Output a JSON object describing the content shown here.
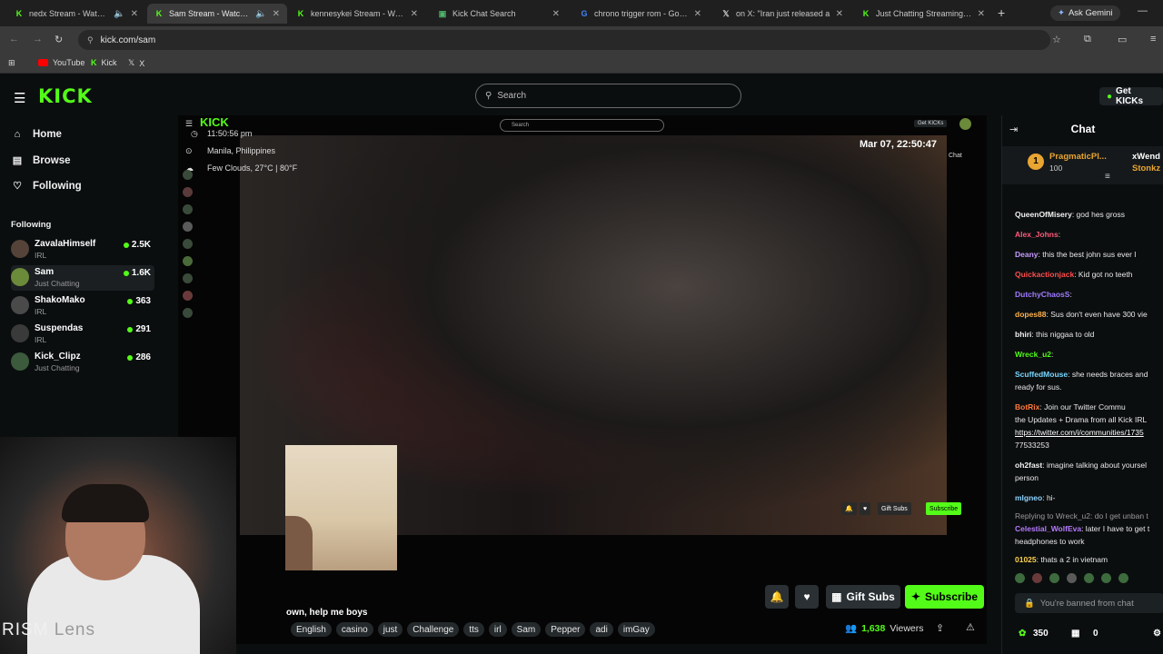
{
  "browser": {
    "tabs": [
      {
        "title": "nedx Stream - Watch Live",
        "active": false
      },
      {
        "title": "Sam Stream - Watch Live",
        "active": true
      },
      {
        "title": "kennesykei Stream - Watch",
        "active": false
      },
      {
        "title": "Kick Chat Search",
        "active": false
      },
      {
        "title": "chrono trigger rom - Google",
        "active": false
      },
      {
        "title": "on X: \"Iran just released a",
        "active": false
      },
      {
        "title": "Just Chatting Streaming - Li",
        "active": false
      }
    ],
    "new_tab": "+",
    "gemini_label": "Ask Gemini",
    "url": "kick.com/sam",
    "bookmarks": [
      "YouTube",
      "Kick",
      "X"
    ]
  },
  "header": {
    "logo": "KICK",
    "search_placeholder": "Search",
    "get_kicks": "Get KICKs"
  },
  "sidebar": {
    "nav": [
      "Home",
      "Browse",
      "Following"
    ],
    "following_heading": "Following",
    "channels": [
      {
        "name": "ZavalaHimself",
        "category": "IRL",
        "viewers": "2.5K"
      },
      {
        "name": "Sam",
        "category": "Just Chatting",
        "viewers": "1.6K"
      },
      {
        "name": "ShakoMako",
        "category": "IRL",
        "viewers": "363"
      },
      {
        "name": "Suspendas",
        "category": "IRL",
        "viewers": "291"
      },
      {
        "name": "Kick_Clipz",
        "category": "Just Chatting",
        "viewers": "286"
      }
    ]
  },
  "player": {
    "time": "11:50:56 pm",
    "location": "Manila, Philippines",
    "weather": "Few Clouds, 27°C | 80°F",
    "datetime": "Mar 07, 22:50:47",
    "inner_search": "Search",
    "inner_getkicks": "Get KICKs",
    "inner_chat": "Chat",
    "mini_gift": "Gift Subs",
    "mini_subscribe": "Subscribe",
    "watermark_main": "RISM",
    "watermark_sub": "Lens"
  },
  "stream": {
    "title": "own, help me boys",
    "tags": [
      "English",
      "casino",
      "just",
      "Challenge",
      "tts",
      "irl",
      "Sam",
      "Pepper",
      "adi",
      "imGay"
    ],
    "gift_subs": "Gift Subs",
    "subscribe": "Subscribe",
    "viewers_count": "1,638",
    "viewers_label": "Viewers"
  },
  "chat": {
    "title": "Chat",
    "pinned_user": "PragmaticPl...",
    "pinned_amount": "100",
    "pinned_right1": "xWend",
    "pinned_right2": "Stonkz",
    "messages": [
      {
        "user": "QueenOfMisery",
        "color": "#f2f2f2",
        "text": ": god hes gross"
      },
      {
        "user": "Alex_Johns",
        "color": "#ff5a7a",
        "text": ":"
      },
      {
        "user": "Deany",
        "color": "#c79bff",
        "text": ": this the best john sus ever l"
      },
      {
        "user": "Quickactionjack",
        "color": "#ff4d4d",
        "text": ": Kid got no teeth"
      },
      {
        "user": "DutchyChaosS",
        "color": "#9f7bff",
        "text": ":"
      },
      {
        "user": "dopes88",
        "color": "#ffb14d",
        "text": ": Sus don't even have 300 vie"
      },
      {
        "user": "bhiri",
        "color": "#f2f2f2",
        "text": ": this niggaa to old"
      },
      {
        "user": "Wreck_u2",
        "color": "#53fc18",
        "text": ":"
      },
      {
        "user": "ScuffedMouse",
        "color": "#7ad7ff",
        "text": ": she needs braces and"
      },
      {
        "user": "",
        "color": "#e8e8e8",
        "text": "ready for sus."
      },
      {
        "user": "BotRix",
        "color": "#ff7a3c",
        "text": ": Join our Twitter Commu"
      },
      {
        "user": "",
        "color": "#e8e8e8",
        "text": "the Updates + Drama from all Kick IRL"
      },
      {
        "user": "",
        "color": "#e8e8e8",
        "text": "https://twitter.com/i/communities/1735"
      },
      {
        "user": "",
        "color": "#e8e8e8",
        "text": "77533253"
      },
      {
        "user": "oh2fast",
        "color": "#f2f2f2",
        "text": ": imagine talking about yoursel"
      },
      {
        "user": "",
        "color": "#e8e8e8",
        "text": "person"
      },
      {
        "user": "mlgneo",
        "color": "#8fd3ff",
        "text": ": hi-"
      },
      {
        "user": "",
        "color": "#9a9a9a",
        "text": "Replying to Wreck_u2: do I get unban t"
      },
      {
        "user": "Celestial_WolfEva",
        "color": "#b57bff",
        "text": ": later I have to get t"
      },
      {
        "user": "",
        "color": "#e8e8e8",
        "text": "headphones to work"
      },
      {
        "user": "01025",
        "color": "#ffd24d",
        "text": ": thats a 2 in vietnam"
      }
    ],
    "banned": "You're banned from chat",
    "kicks_balance": "350",
    "gifts_balance": "0"
  },
  "colors": {
    "accent": "#53fc18"
  }
}
